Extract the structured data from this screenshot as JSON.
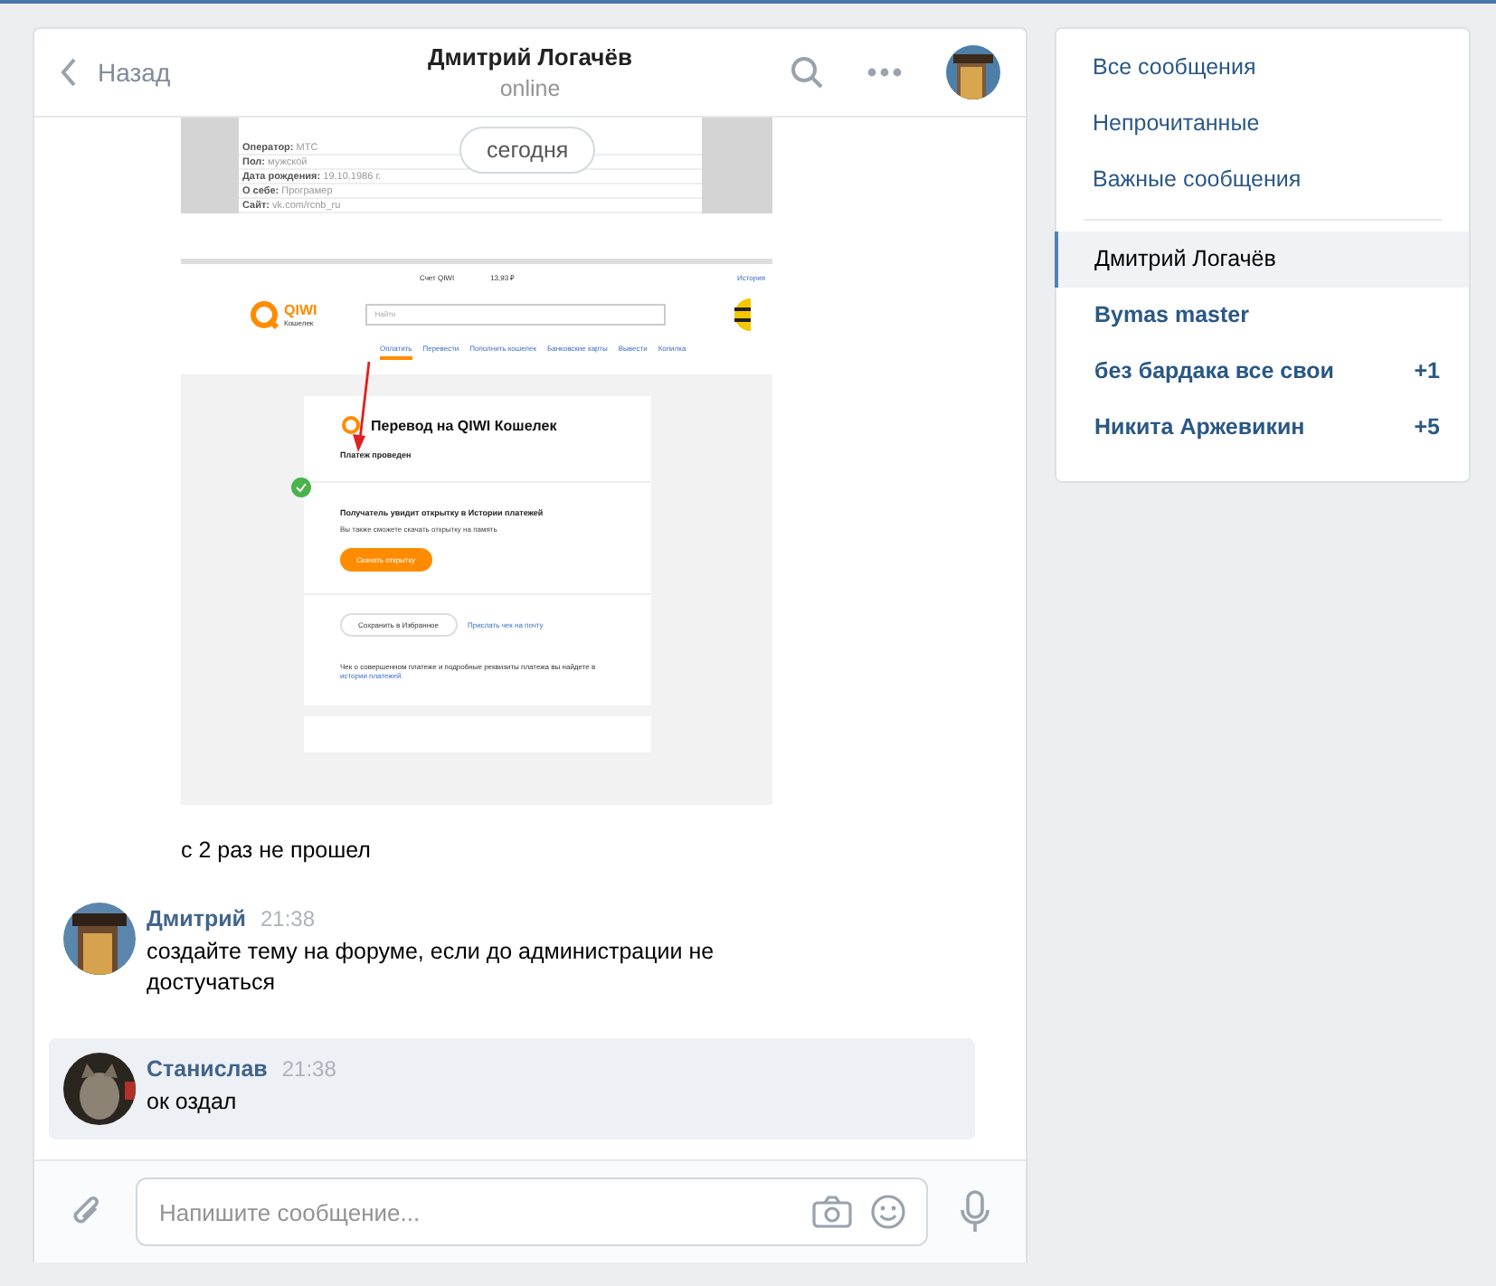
{
  "header": {
    "back_label": "Назад",
    "title": "Дмитрий Логачёв",
    "status": "online"
  },
  "date_pill": "сегодня",
  "profile_shot": {
    "rows": [
      {
        "label": "Оператор:",
        "value": "МТС"
      },
      {
        "label": "Пол:",
        "value": "мужской"
      },
      {
        "label": "Дата рождения:",
        "value": "19.10.1986 г."
      },
      {
        "label": "О себе:",
        "value": "Програмер"
      },
      {
        "label": "Сайт:",
        "value": "vk.com/rcnb_ru"
      }
    ]
  },
  "qiwi_shot": {
    "account": "Счет QIWI",
    "balance": "13,93 ₽",
    "history": "История",
    "logo": "QIWI",
    "logo_sub": "Кошелек",
    "search_placeholder": "Найти",
    "nav": [
      {
        "label": "Оплатить",
        "selected": true
      },
      {
        "label": "Перевести",
        "selected": false
      },
      {
        "label": "Пополнить кошелек",
        "selected": false
      },
      {
        "label": "Банковские карты",
        "selected": false
      },
      {
        "label": "Вывести",
        "selected": false
      },
      {
        "label": "Копилка",
        "selected": false
      }
    ],
    "title": "Перевод на QIWI Кошелек",
    "status": "Платеж проведен",
    "card_title": "Получатель увидит открытку в Истории платежей",
    "card_text": "Вы также сможете скачать открытку на память",
    "download": "Скачать открытку",
    "favorite": "Сохранить в Избранное",
    "email": "Прислать чек на почту",
    "note": "Чек о совершенном платеже и подробные реквизиты платежа вы найдете в",
    "note_link": "истории платежей."
  },
  "continued_text": "с 2 раз не прошел",
  "messages": [
    {
      "sender": "Дмитрий",
      "time": "21:38",
      "text": "создайте тему на форуме, если до администрации не достучаться",
      "selected": false
    },
    {
      "sender": "Станислав",
      "time": "21:38",
      "text": "ок оздал",
      "selected": true
    }
  ],
  "composer": {
    "placeholder": "Напишите сообщение..."
  },
  "sidebar": {
    "filters": [
      {
        "label": "Все сообщения"
      },
      {
        "label": "Непрочитанные"
      },
      {
        "label": "Важные сообщения"
      }
    ],
    "chats": [
      {
        "name": "Дмитрий Логачёв",
        "selected": true
      },
      {
        "name": "Bymas master",
        "selected": false
      },
      {
        "name": "без бардака все свои",
        "badge": "+1",
        "selected": false
      },
      {
        "name": "Никита Аржевикин",
        "badge": "+5",
        "selected": false
      }
    ]
  }
}
